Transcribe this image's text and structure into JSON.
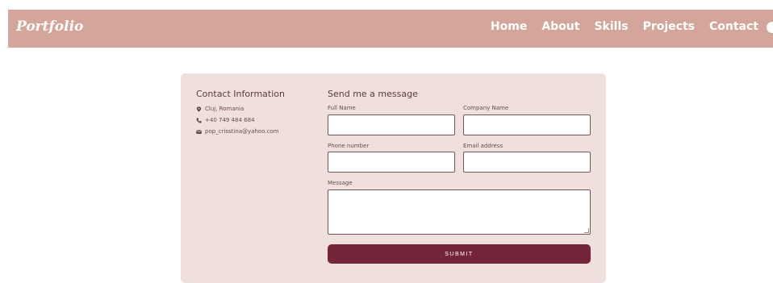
{
  "nav": {
    "logo": "Portfolio",
    "links": [
      "Home",
      "About",
      "Skills",
      "Projects",
      "Contact"
    ]
  },
  "contact_info": {
    "title": "Contact Information",
    "location": "Cluj, Romania",
    "phone": "+40 749 484 684",
    "email": "pop_crisstina@yahoo.com"
  },
  "form": {
    "title": "Send me a message",
    "full_name_label": "Full Name",
    "company_name_label": "Company Name",
    "phone_label": "Phone number",
    "email_label": "Email address",
    "message_label": "Message",
    "submit_label": "SUBMIT"
  },
  "colors": {
    "navbar": "#d3a59b",
    "card": "#efdfdd",
    "submit": "#74253a"
  }
}
